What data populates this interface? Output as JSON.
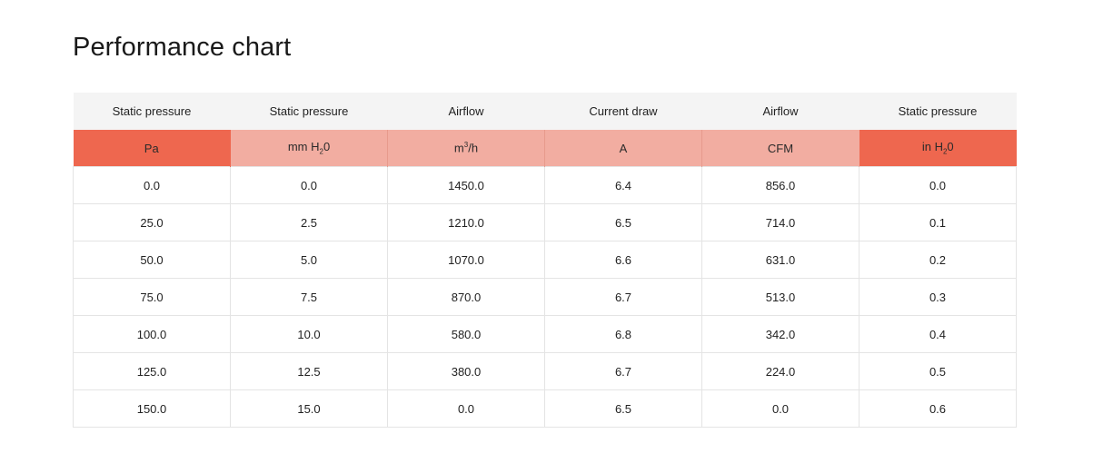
{
  "title": "Performance chart",
  "colors": {
    "accent_strong": "#ee674f",
    "accent_light": "#f2ada1",
    "header_bg": "#f4f4f4",
    "grid": "#e4e4e4"
  },
  "table": {
    "headers": [
      "Static pressure",
      "Static pressure",
      "Airflow",
      "Current draw",
      "Airflow",
      "Static pressure"
    ],
    "units": [
      {
        "pre": "Pa",
        "sub": "",
        "sup": "",
        "post": "",
        "style": "strong"
      },
      {
        "pre": "mm H",
        "sub": "2",
        "sup": "",
        "post": "0",
        "style": "light"
      },
      {
        "pre": "m",
        "sub": "",
        "sup": "3",
        "post": "/h",
        "style": "light"
      },
      {
        "pre": "A",
        "sub": "",
        "sup": "",
        "post": "",
        "style": "light"
      },
      {
        "pre": "CFM",
        "sub": "",
        "sup": "",
        "post": "",
        "style": "light"
      },
      {
        "pre": "in H",
        "sub": "2",
        "sup": "",
        "post": "0",
        "style": "strong"
      }
    ],
    "rows": [
      [
        "0.0",
        "0.0",
        "1450.0",
        "6.4",
        "856.0",
        "0.0"
      ],
      [
        "25.0",
        "2.5",
        "1210.0",
        "6.5",
        "714.0",
        "0.1"
      ],
      [
        "50.0",
        "5.0",
        "1070.0",
        "6.6",
        "631.0",
        "0.2"
      ],
      [
        "75.0",
        "7.5",
        "870.0",
        "6.7",
        "513.0",
        "0.3"
      ],
      [
        "100.0",
        "10.0",
        "580.0",
        "6.8",
        "342.0",
        "0.4"
      ],
      [
        "125.0",
        "12.5",
        "380.0",
        "6.7",
        "224.0",
        "0.5"
      ],
      [
        "150.0",
        "15.0",
        "0.0",
        "6.5",
        "0.0",
        "0.6"
      ]
    ]
  }
}
